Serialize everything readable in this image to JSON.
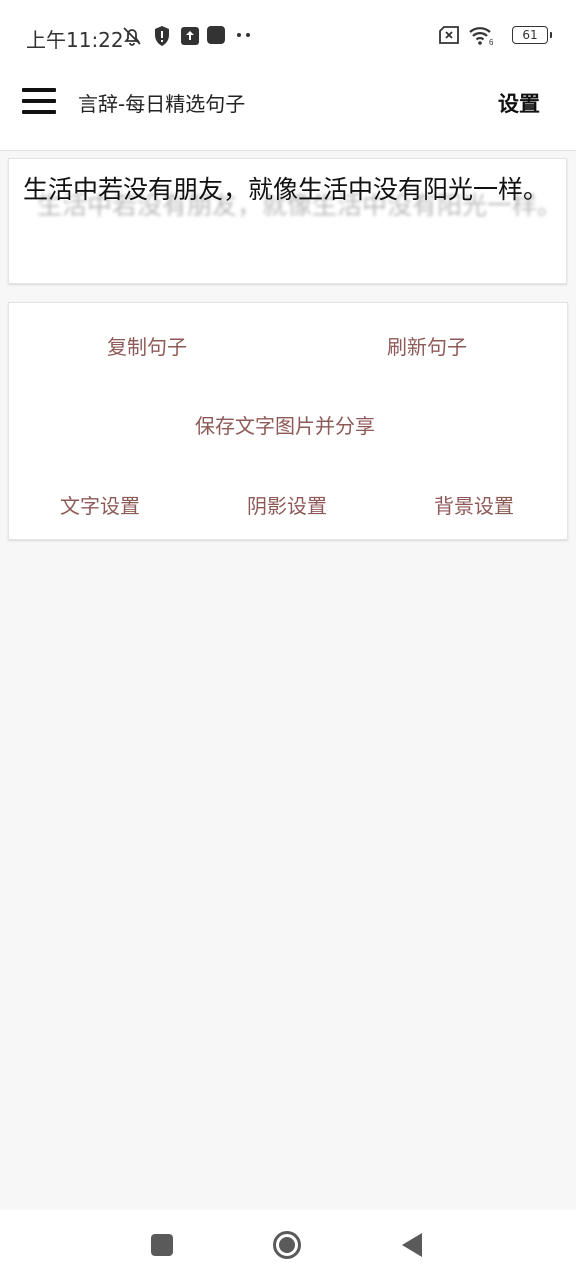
{
  "status_bar": {
    "time": "上午11:22",
    "icons": [
      "bell-off-icon",
      "shield-alert-icon",
      "upload-icon",
      "app-square-icon",
      "more-dots-icon"
    ],
    "right_icons": [
      "sim-off-icon",
      "wifi-icon"
    ],
    "wifi_label": "6",
    "battery": "61"
  },
  "app_bar": {
    "title": "言辞-每日精选句子",
    "settings_label": "设置"
  },
  "sentence": {
    "text": "生活中若没有朋友，就像生活中没有阳光一样。"
  },
  "actions": {
    "copy_label": "复制句子",
    "refresh_label": "刷新句子",
    "save_share_label": "保存文字图片并分享",
    "text_settings_label": "文字设置",
    "shadow_settings_label": "阴影设置",
    "background_settings_label": "背景设置"
  },
  "nav_bar": {
    "icons": [
      "recents-square-icon",
      "home-circle-icon",
      "back-triangle-icon"
    ]
  },
  "colors": {
    "accent_text": "#8e5a58",
    "background": "#f7f7f7"
  }
}
